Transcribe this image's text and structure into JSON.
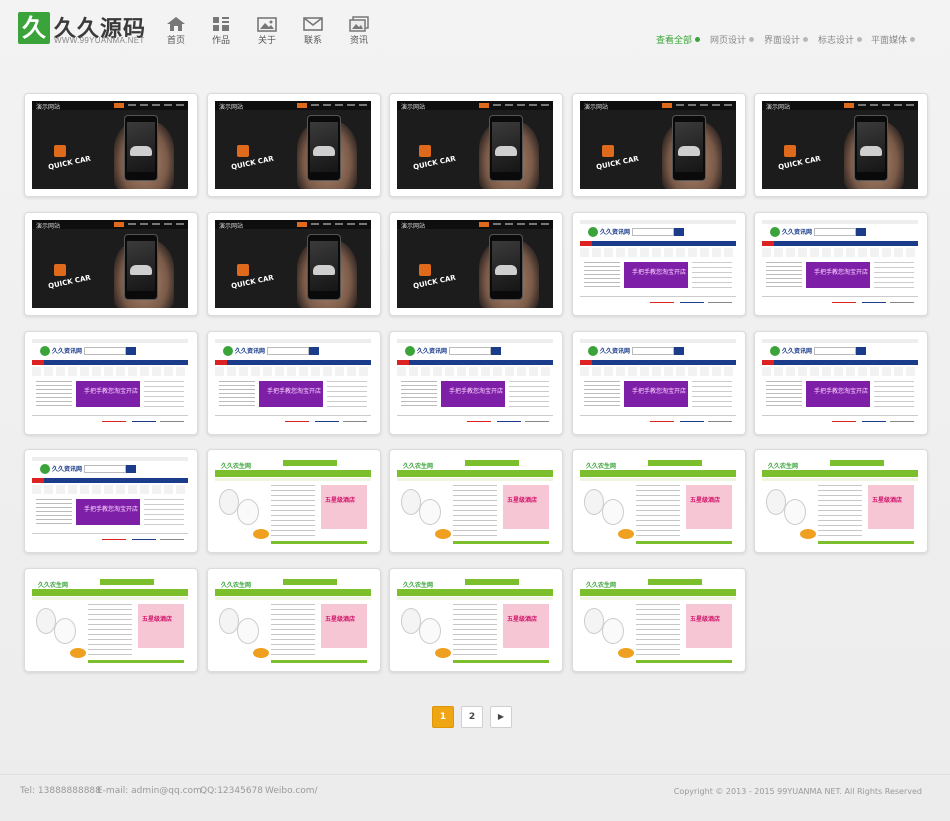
{
  "brand": {
    "name": "久久源码",
    "badge": "久",
    "url": "WWW.99YUANMA.NET"
  },
  "nav": [
    {
      "label": "首页",
      "icon": "home-icon"
    },
    {
      "label": "作品",
      "icon": "grid-icon"
    },
    {
      "label": "关于",
      "icon": "image-icon"
    },
    {
      "label": "联系",
      "icon": "mail-icon"
    },
    {
      "label": "资讯",
      "icon": "photos-icon"
    }
  ],
  "filters": [
    {
      "label": "查看全部",
      "active": true
    },
    {
      "label": "网页设计",
      "active": false
    },
    {
      "label": "界面设计",
      "active": false
    },
    {
      "label": "标志设计",
      "active": false
    },
    {
      "label": "平面媒体",
      "active": false
    }
  ],
  "thumb_text": {
    "phone_brand": "演示网站",
    "phone_title": "QUICK CAR",
    "news_logo": "久久资讯网",
    "news_ad": "手把手教您淘宝开店",
    "eco_logo": "久久农生网",
    "eco_promo": "五星级酒店"
  },
  "portfolio": [
    "phone",
    "phone",
    "phone",
    "phone",
    "phone",
    "phone",
    "phone",
    "phone",
    "news",
    "news",
    "news",
    "news",
    "news",
    "news",
    "news",
    "news",
    "eco",
    "eco",
    "eco",
    "eco",
    "eco",
    "eco",
    "eco",
    "eco"
  ],
  "pagination": {
    "pages": [
      "1",
      "2"
    ],
    "current": "1",
    "next": "▶"
  },
  "footer": {
    "tel": "Tel: 13888888888",
    "email": "E-mail: admin@qq.com",
    "qq": "QQ:12345678",
    "weibo": "Weibo.com/",
    "copyright": "Copyright © 2013 - 2015 99YUANMA NET. All Rights Reserved"
  },
  "colors": {
    "accent": "#3aa43a",
    "pager_active": "#f0a514"
  }
}
